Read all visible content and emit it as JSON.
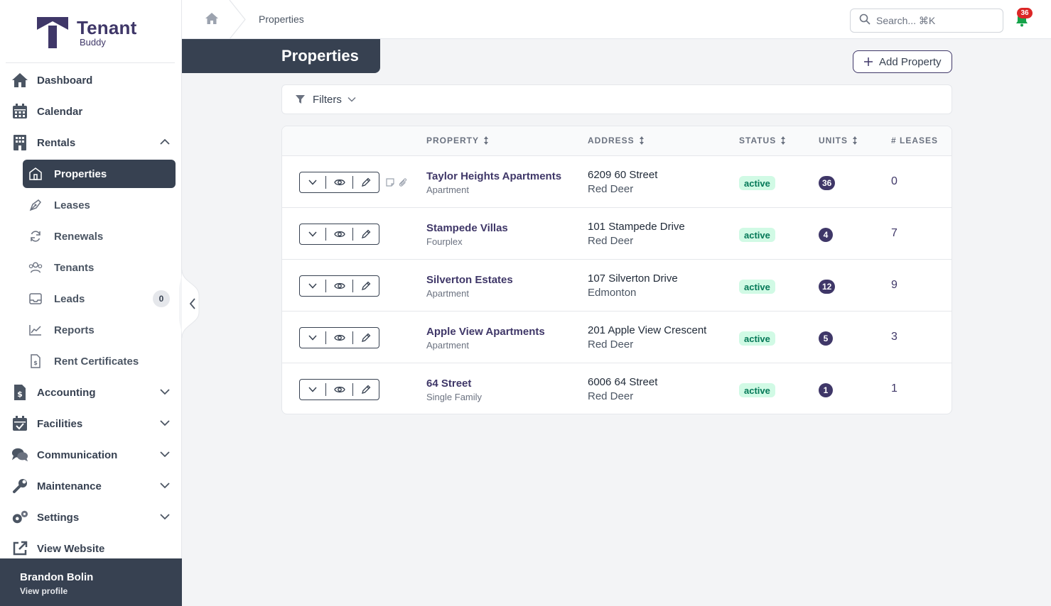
{
  "brand": {
    "name": "Tenant",
    "sub": "Buddy",
    "color": "#3f3768"
  },
  "sidebar": {
    "main_items": [
      {
        "label": "Dashboard",
        "icon": "home-icon"
      },
      {
        "label": "Calendar",
        "icon": "calendar-icon"
      },
      {
        "label": "Rentals",
        "icon": "building-icon",
        "expanded": true
      }
    ],
    "rental_items": [
      {
        "label": "Properties",
        "icon": "house-icon",
        "active": true
      },
      {
        "label": "Leases",
        "icon": "pen-nib-icon"
      },
      {
        "label": "Renewals",
        "icon": "refresh-icon"
      },
      {
        "label": "Tenants",
        "icon": "users-icon"
      },
      {
        "label": "Leads",
        "icon": "inbox-icon",
        "badge": "0"
      },
      {
        "label": "Reports",
        "icon": "line-chart-icon"
      },
      {
        "label": "Rent Certificates",
        "icon": "receipt-icon"
      }
    ],
    "section_items": [
      {
        "label": "Accounting",
        "icon": "dollar-file-icon"
      },
      {
        "label": "Facilities",
        "icon": "calendar-check-icon"
      },
      {
        "label": "Communication",
        "icon": "chat-icon"
      },
      {
        "label": "Maintenance",
        "icon": "wrench-icon"
      },
      {
        "label": "Settings",
        "icon": "gears-icon"
      }
    ],
    "view_website": "View Website",
    "profile": {
      "name": "Brandon Bolin",
      "link": "View profile"
    }
  },
  "topbar": {
    "breadcrumb": "Properties",
    "search_placeholder": "Search... ⌘K",
    "notification_count": "36"
  },
  "page": {
    "title": "Properties",
    "add_button": "Add Property",
    "filters_label": "Filters"
  },
  "table": {
    "columns": [
      "PROPERTY",
      "ADDRESS",
      "STATUS",
      "UNITS",
      "# LEASES"
    ],
    "rows": [
      {
        "name": "Taylor Heights Apartments",
        "type": "Apartment",
        "street": "6209 60 Street",
        "city": "Red Deer",
        "status": "active",
        "units": "36",
        "leases": "0"
      },
      {
        "name": "Stampede Villas",
        "type": "Fourplex",
        "street": "101 Stampede Drive",
        "city": "Red Deer",
        "status": "active",
        "units": "4",
        "leases": "7"
      },
      {
        "name": "Silverton Estates",
        "type": "Apartment",
        "street": "107 Silverton Drive",
        "city": "Edmonton",
        "status": "active",
        "units": "12",
        "leases": "9"
      },
      {
        "name": "Apple View Apartments",
        "type": "Apartment",
        "street": "201 Apple View Crescent",
        "city": "Red Deer",
        "status": "active",
        "units": "5",
        "leases": "3"
      },
      {
        "name": "64 Street",
        "type": "Single Family",
        "street": "6006 64 Street",
        "city": "Red Deer",
        "status": "active",
        "units": "1",
        "leases": "1"
      }
    ]
  }
}
